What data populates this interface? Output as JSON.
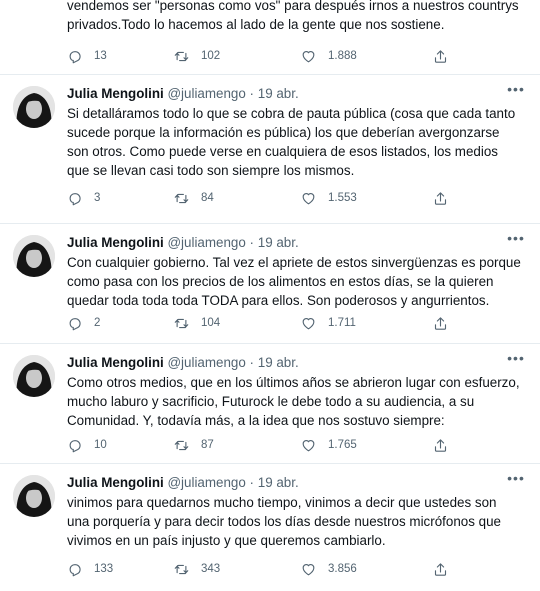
{
  "colors": {
    "text": "#0f1419",
    "secondary": "#536471",
    "divider": "#e6ecf0"
  },
  "icons": {
    "reply": "reply-icon",
    "retweet": "retweet-icon",
    "like": "like-icon",
    "share": "share-icon",
    "more": "more-icon"
  },
  "partial_tweet": {
    "text": "vendemos ser \"personas como vos\" para después irnos a nuestros countrys\nprivados.Todo lo hacemos al lado de la gente que nos sostiene.",
    "stats": {
      "replies": "13",
      "retweets": "102",
      "likes": "1.888"
    }
  },
  "tweets": [
    {
      "name": "Julia Mengolini",
      "handle": "@juliamengo",
      "separator": "·",
      "date": "19 abr.",
      "text": "Si detalláramos todo lo que se cobra de pauta pública (cosa que cada tanto\nsucede porque la información es pública) los que deberían avergonzarse\nson otros. Como puede verse en cualquiera de esos listados, los medios\nque se llevan casi todo son siempre los mismos.",
      "stats": {
        "replies": "3",
        "retweets": "84",
        "likes": "1.553"
      }
    },
    {
      "name": "Julia Mengolini",
      "handle": "@juliamengo",
      "separator": "·",
      "date": "19 abr.",
      "text": "Con cualquier gobierno. Tal vez el apriete de estos sinvergüenzas es porque\ncomo pasa con los precios de los alimentos en estos días, se la quieren\nquedar toda toda toda TODA para ellos. Son poderosos y angurrientos.",
      "stats": {
        "replies": "2",
        "retweets": "104",
        "likes": "1.711"
      }
    },
    {
      "name": "Julia Mengolini",
      "handle": "@juliamengo",
      "separator": "·",
      "date": "19 abr.",
      "text": "Como otros medios, que en los últimos años se abrieron lugar con esfuerzo,\nmucho laburo y sacrificio, Futurock le debe todo a su audiencia, a su\nComunidad. Y, todavía más, a la idea que nos sostuvo siempre:",
      "stats": {
        "replies": "10",
        "retweets": "87",
        "likes": "1.765"
      }
    },
    {
      "name": "Julia Mengolini",
      "handle": "@juliamengo",
      "separator": "·",
      "date": "19 abr.",
      "text": "vinimos para quedarnos mucho tiempo, vinimos a decir que ustedes son\nuna porquería  y para decir todos los días desde nuestros micrófonos que\nvivimos en un país injusto y que queremos cambiarlo.",
      "stats": {
        "replies": "133",
        "retweets": "343",
        "likes": "3.856"
      }
    }
  ]
}
